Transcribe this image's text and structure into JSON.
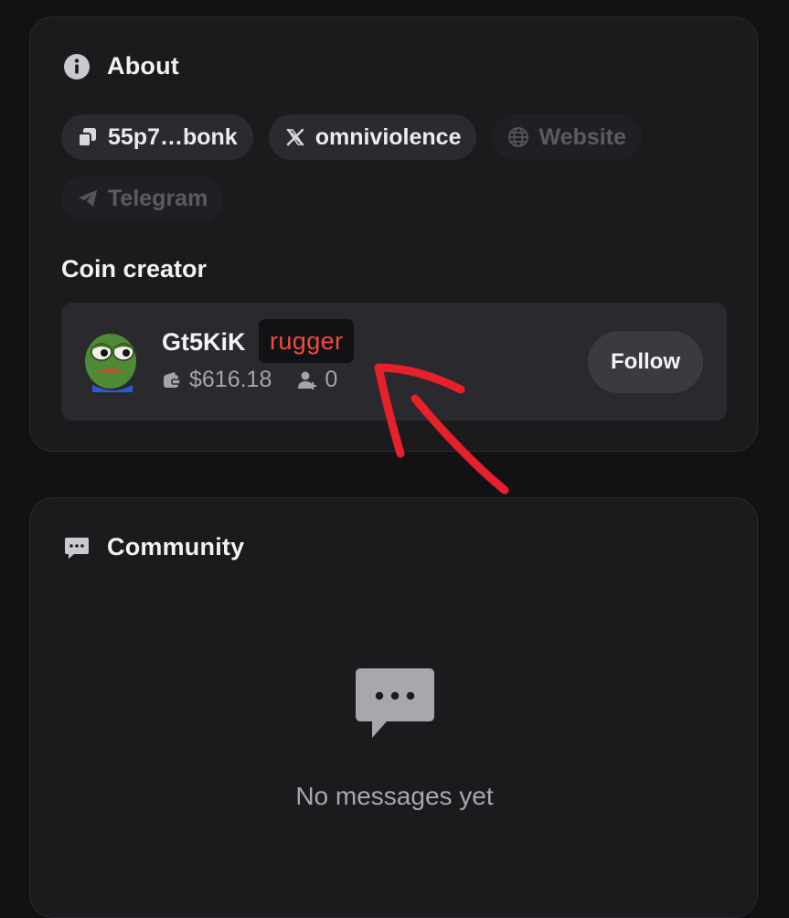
{
  "about": {
    "title": "About",
    "links": [
      {
        "label": "55p7…bonk",
        "icon": "copy-icon",
        "enabled": true
      },
      {
        "label": "omniviolence",
        "icon": "x-logo-icon",
        "enabled": true
      },
      {
        "label": "Website",
        "icon": "globe-icon",
        "enabled": false
      },
      {
        "label": "Telegram",
        "icon": "telegram-icon",
        "enabled": false
      }
    ]
  },
  "creator": {
    "section_label": "Coin creator",
    "name": "Gt5KiK",
    "tag": "rugger",
    "balance": "$616.18",
    "followers": "0",
    "follow_label": "Follow",
    "avatar_icon": "pepe-frog-avatar"
  },
  "community": {
    "title": "Community",
    "empty_message": "No messages yet"
  },
  "colors": {
    "background": "#121214",
    "card": "#1b1b1e",
    "tag_text": "#f04c3e",
    "annotation": "#e8202a"
  }
}
